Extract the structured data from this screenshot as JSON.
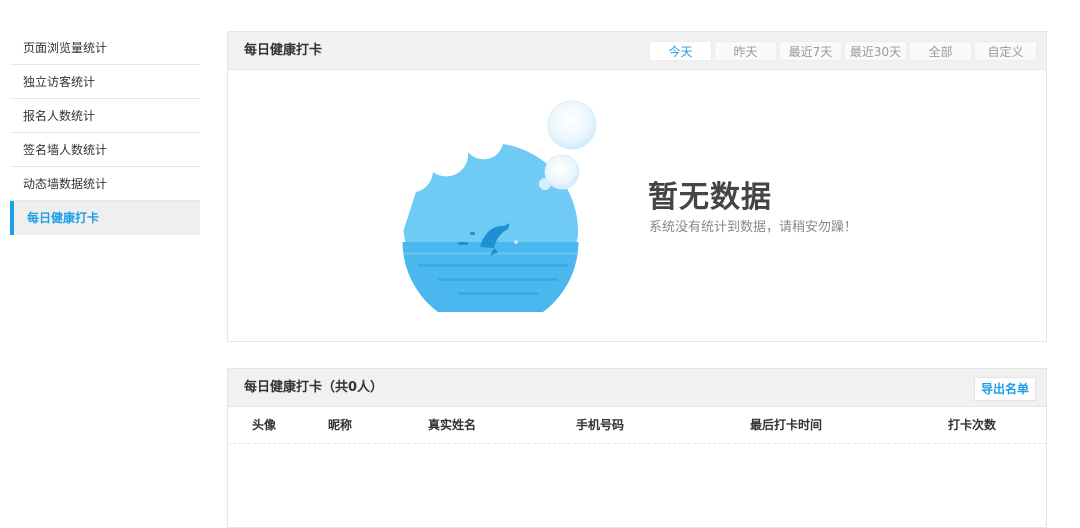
{
  "sidebar": {
    "items": [
      {
        "label": "页面浏览量统计"
      },
      {
        "label": "独立访客统计"
      },
      {
        "label": "报名人数统计"
      },
      {
        "label": "签名墙人数统计"
      },
      {
        "label": "动态墙数据统计"
      },
      {
        "label": "每日健康打卡"
      }
    ],
    "active_index": 5
  },
  "chart_panel": {
    "title": "每日健康打卡",
    "tabs": [
      "今天",
      "昨天",
      "最近7天",
      "最近30天",
      "全部",
      "自定义"
    ],
    "active_tab": "今天",
    "empty": {
      "title": "暂无数据",
      "subtitle": "系统没有统计到数据，请稍安勿躁！",
      "illustration_icon": "dolphin-bubble-illustration"
    }
  },
  "list_panel": {
    "title": "每日健康打卡（共0人）",
    "export_label": "导出名单",
    "columns": [
      "头像",
      "昵称",
      "真实姓名",
      "手机号码",
      "最后打卡时间",
      "打卡次数"
    ],
    "rows": []
  },
  "colors": {
    "accent": "#1e9fe6",
    "header_bg": "#f1f1f1",
    "border": "#e6e6e6"
  }
}
